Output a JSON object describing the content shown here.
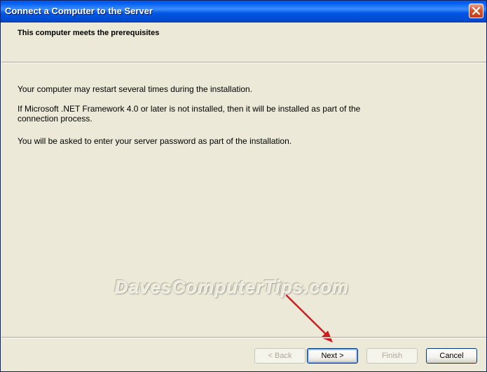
{
  "window": {
    "title": "Connect a Computer to the Server"
  },
  "header": {
    "title": "This computer meets the prerequisites"
  },
  "body": {
    "paragraph_1": "Your computer may restart several times during the installation.",
    "paragraph_2": "If Microsoft .NET Framework 4.0 or later is not installed, then it will be installed as part of the connection process.",
    "paragraph_3": "You will be asked to enter your server password as part of the installation."
  },
  "watermark": {
    "text": "DavesComputerTips.com"
  },
  "buttons": {
    "back": "< Back",
    "next": "Next >",
    "finish": "Finish",
    "cancel": "Cancel"
  },
  "icons": {
    "close": "close-icon",
    "arrow": "red-arrow-annotation"
  },
  "colors": {
    "titlebar": "#0054E3",
    "dialog_background": "#ECE9D8",
    "close_button": "#D9542A",
    "arrow": "#CC1E1E"
  }
}
